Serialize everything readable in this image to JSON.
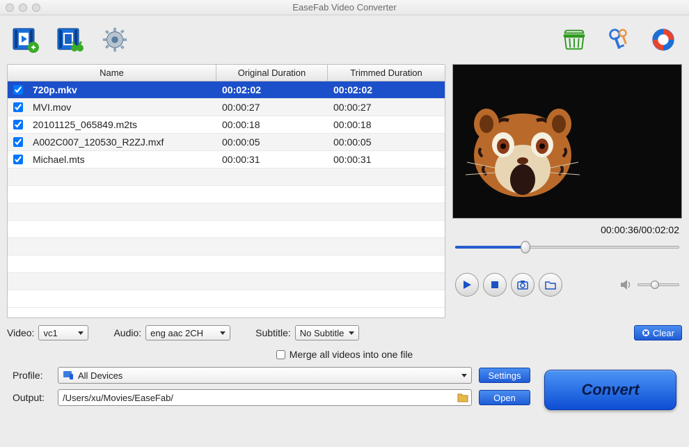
{
  "window": {
    "title": "EaseFab Video Converter"
  },
  "columns": {
    "name": "Name",
    "od": "Original Duration",
    "td": "Trimmed Duration"
  },
  "files": [
    {
      "name": "720p.mkv",
      "od": "00:02:02",
      "td": "00:02:02",
      "selected": true,
      "checked": true
    },
    {
      "name": "MVI.mov",
      "od": "00:00:27",
      "td": "00:00:27",
      "selected": false,
      "checked": true
    },
    {
      "name": "20101125_065849.m2ts",
      "od": "00:00:18",
      "td": "00:00:18",
      "selected": false,
      "checked": true
    },
    {
      "name": "A002C007_120530_R2ZJ.mxf",
      "od": "00:00:05",
      "td": "00:00:05",
      "selected": false,
      "checked": true
    },
    {
      "name": "Michael.mts",
      "od": "00:00:31",
      "td": "00:00:31",
      "selected": false,
      "checked": true
    }
  ],
  "preview": {
    "position": "00:00:36",
    "duration": "00:02:02"
  },
  "tracks": {
    "video_label": "Video:",
    "video_value": "vc1",
    "audio_label": "Audio:",
    "audio_value": "eng aac 2CH",
    "subtitle_label": "Subtitle:",
    "subtitle_value": "No Subtitle",
    "clear": "Clear"
  },
  "merge": {
    "label": "Merge all videos into one file",
    "checked": false
  },
  "profile": {
    "label": "Profile:",
    "value": "All Devices",
    "settings": "Settings"
  },
  "output": {
    "label": "Output:",
    "value": "/Users/xu/Movies/EaseFab/",
    "open": "Open"
  },
  "convert": {
    "label": "Convert"
  }
}
